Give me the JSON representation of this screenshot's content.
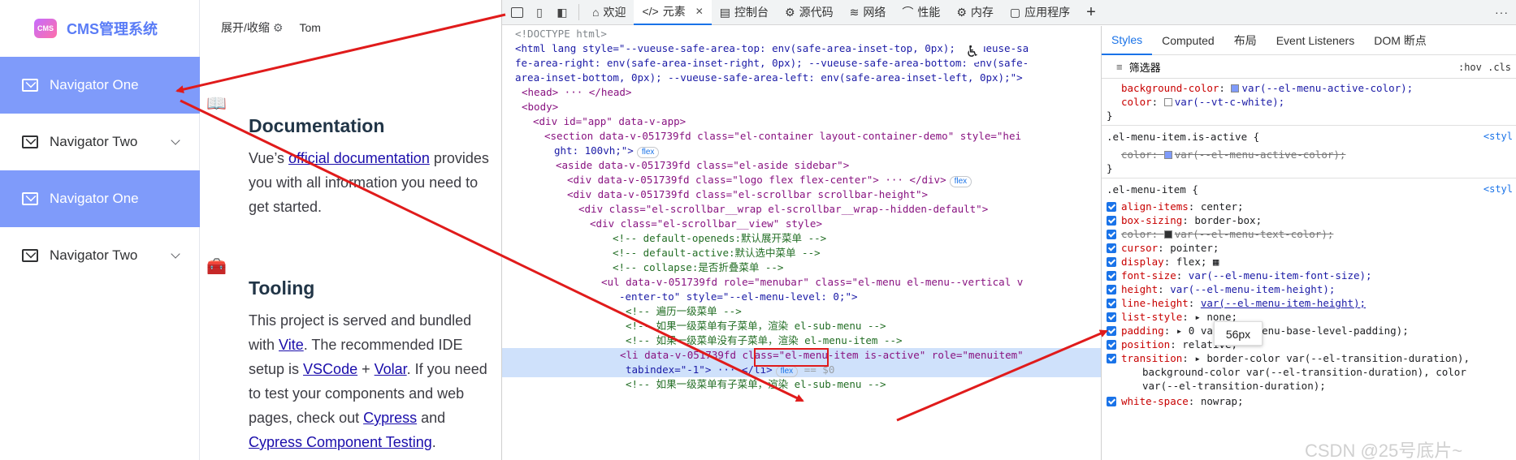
{
  "app": {
    "logo_badge": "CMS",
    "logo_title": "CMS管理系统",
    "toggle_label": "展开/收缩",
    "user_name": "Tom",
    "menu": [
      {
        "label": "Navigator One"
      },
      {
        "label": "Navigator Two"
      },
      {
        "label": "Navigator One"
      },
      {
        "label": "Navigator Two"
      }
    ],
    "docs": {
      "title": "Documentation",
      "t1": "Vue’s ",
      "link1": "official documentation",
      "t2": " provides you with all information you need to get started."
    },
    "tooling": {
      "title": "Tooling",
      "t1": "This project is served and bundled with ",
      "link1": "Vite",
      "t2": ". The recommended IDE setup is ",
      "link2": "VSCode",
      "t3": " + ",
      "link3": "Volar",
      "t4": ". If you need to test your components and web pages, check out ",
      "link4": "Cypress",
      "t5": " and ",
      "link5": "Cypress Component Testing",
      "t6": "."
    }
  },
  "devtools": {
    "tabs": [
      {
        "icon": "⌂",
        "label": "欢迎"
      },
      {
        "icon": "</>",
        "label": "元素"
      },
      {
        "icon": "▤",
        "label": "控制台"
      },
      {
        "icon": "⚙",
        "label": "源代码"
      },
      {
        "icon": "≋",
        "label": "网络"
      },
      {
        "icon": "⌒",
        "label": "性能"
      },
      {
        "icon": "⚙",
        "label": "内存"
      },
      {
        "icon": "▢",
        "label": "应用程序"
      }
    ],
    "add_tab": "+",
    "more": "···",
    "close": "✕",
    "elements_lines": [
      "<!DOCTYPE html>",
      "<html lang style=\"--vueuse-safe-area-top: env(safe-area-inset-top, 0px); --vueuse-sa",
      "fe-area-right: env(safe-area-inset-right, 0px); --vueuse-safe-area-bottom: env(safe-",
      "area-inset-bottom, 0px); --vueuse-safe-area-left: env(safe-area-inset-left, 0px);\">",
      "<head> ··· </head>",
      "<body>",
      "<div id=\"app\" data-v-app>",
      "<section data-v-051739fd class=\"el-container layout-container-demo\" style=\"hei",
      "ght: 100vh;\">",
      "<aside data-v-051739fd class=\"el-aside sidebar\">",
      "<div data-v-051739fd class=\"logo flex flex-center\"> ··· </div>",
      "<div data-v-051739fd class=\"el-scrollbar scrollbar-height\">",
      "<div class=\"el-scrollbar__wrap el-scrollbar__wrap--hidden-default\">",
      "<div class=\"el-scrollbar__view\" style>",
      "<!-- default-openeds:默认展开菜单 -->",
      "<!-- default-active:默认选中菜单 -->",
      "<!-- collapse:是否折叠菜单 -->",
      "<ul data-v-051739fd role=\"menubar\" class=\"el-menu el-menu--vertical v",
      "-enter-to\" style=\"--el-menu-level: 0;\">",
      "<!-- 遍历一级菜单 -->",
      "<!-- 如果一级菜单有子菜单，渲染 el-sub-menu -->",
      "<!-- 如果一级菜单没有子菜单，渲染 el-menu-item -->",
      "<li data-v-051739fd class=\"el-menu-item is-active\" role=\"menuitem\"",
      "tabindex=\"-1\"> ··· </li>",
      "<!-- 如果一级菜单有子菜单，渲染 el-sub-menu -->"
    ],
    "flex_badge": "flex",
    "eq0": "== $0",
    "style_tabs": [
      "Styles",
      "Computed",
      "布局",
      "Event Listeners",
      "DOM 断点"
    ],
    "filter_placeholder": "筛选器",
    "filter_meta": ":hov .cls",
    "style_src": "<styl",
    "rules": {
      "r0_prop": "background-color",
      "r0_val": "var(--el-menu-active-color);",
      "r0b_prop": "color",
      "r0b_val": "var(--vt-c-white);",
      "sel1": ".el-menu-item.is-active {",
      "r1_prop": "color",
      "r1_val": "var(--el-menu-active-color);",
      "sel2": ".el-menu-item {",
      "props": [
        {
          "p": "align-items",
          "v": "center;"
        },
        {
          "p": "box-sizing",
          "v": "border-box;"
        },
        {
          "p": "color",
          "v": "var(--el-menu-text-color);"
        },
        {
          "p": "cursor",
          "v": "pointer;"
        },
        {
          "p": "display",
          "v": "flex;"
        },
        {
          "p": "font-size",
          "v": "var(--el-menu-item-font-size);"
        },
        {
          "p": "height",
          "v": "var(--el-menu-item-height);"
        },
        {
          "p": "line-height",
          "v": "var(--el-menu-item-height);"
        },
        {
          "p": "list-style",
          "v": "none;"
        },
        {
          "p": "padding",
          "v": "0 var(--el-menu-base-level-padding);"
        },
        {
          "p": "position",
          "v": "relative;"
        },
        {
          "p": "transition",
          "v": "border-color var(--el-transition-duration),"
        },
        {
          "p": "",
          "v": "background-color var(--el-transition-duration), color"
        },
        {
          "p": "",
          "v": "var(--el-transition-duration);"
        },
        {
          "p": "white-space",
          "v": "nowrap;"
        }
      ],
      "tooltip": "56px"
    },
    "watermark": "CSDN @25号底片~"
  },
  "colors": {
    "menu_active_bg": "#7f9bfa",
    "accent": "#1a73e8",
    "annotation": "#e01b1b",
    "logo": "#5a7cf6"
  }
}
